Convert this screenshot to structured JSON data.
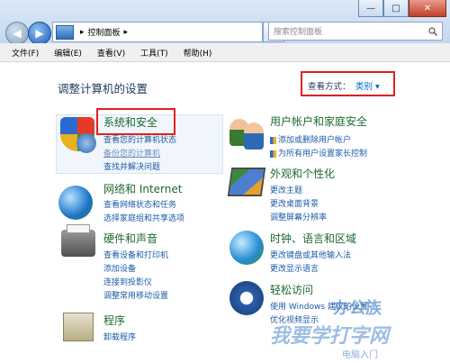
{
  "titlebar": {
    "minimize": "—",
    "maximize": "□",
    "close": "✕",
    "back": "◀",
    "forward": "▶",
    "address": "控制面板",
    "address_arrow": "▸",
    "refresh": "⟳",
    "search_placeholder": "搜索控制面板",
    "search_icon": "search-icon"
  },
  "menu": [
    "文件(F)",
    "编辑(E)",
    "查看(V)",
    "工具(T)",
    "帮助(H)"
  ],
  "main": {
    "heading": "调整计算机的设置",
    "view_by_label": "查看方式：",
    "view_by_value": "类别 ▾"
  },
  "categories": {
    "system": {
      "title": "系统和安全",
      "links": [
        "查看您的计算机状态",
        "备份您的计算机",
        "查找并解决问题"
      ]
    },
    "user": {
      "title": "用户帐户和家庭安全",
      "links": [
        "添加或删除用户帐户",
        "为所有用户设置家长控制"
      ]
    },
    "network": {
      "title": "网络和 Internet",
      "links": [
        "查看网络状态和任务",
        "选择家庭组和共享选项"
      ]
    },
    "appearance": {
      "title": "外观和个性化",
      "links": [
        "更改主题",
        "更改桌面背景",
        "调整屏幕分辨率"
      ]
    },
    "hardware": {
      "title": "硬件和声音",
      "links": [
        "查看设备和打印机",
        "添加设备",
        "连接到投影仪",
        "调整常用移动设置"
      ]
    },
    "clock": {
      "title": "时钟、语言和区域",
      "links": [
        "更改键盘或其他输入法",
        "更改显示语言"
      ]
    },
    "ease": {
      "title": "轻松访问",
      "links": [
        "使用 Windows 建议的设置",
        "优化视频显示"
      ]
    },
    "programs": {
      "title": "程序",
      "links": [
        "卸载程序"
      ]
    }
  },
  "watermark": {
    "line1": "办公族",
    "line2": "我要学打字网",
    "line3": "电脑入门"
  },
  "colors": {
    "category_title": "#1e6a30",
    "link": "#1c5aa8",
    "highlight_box": "#e02020"
  }
}
